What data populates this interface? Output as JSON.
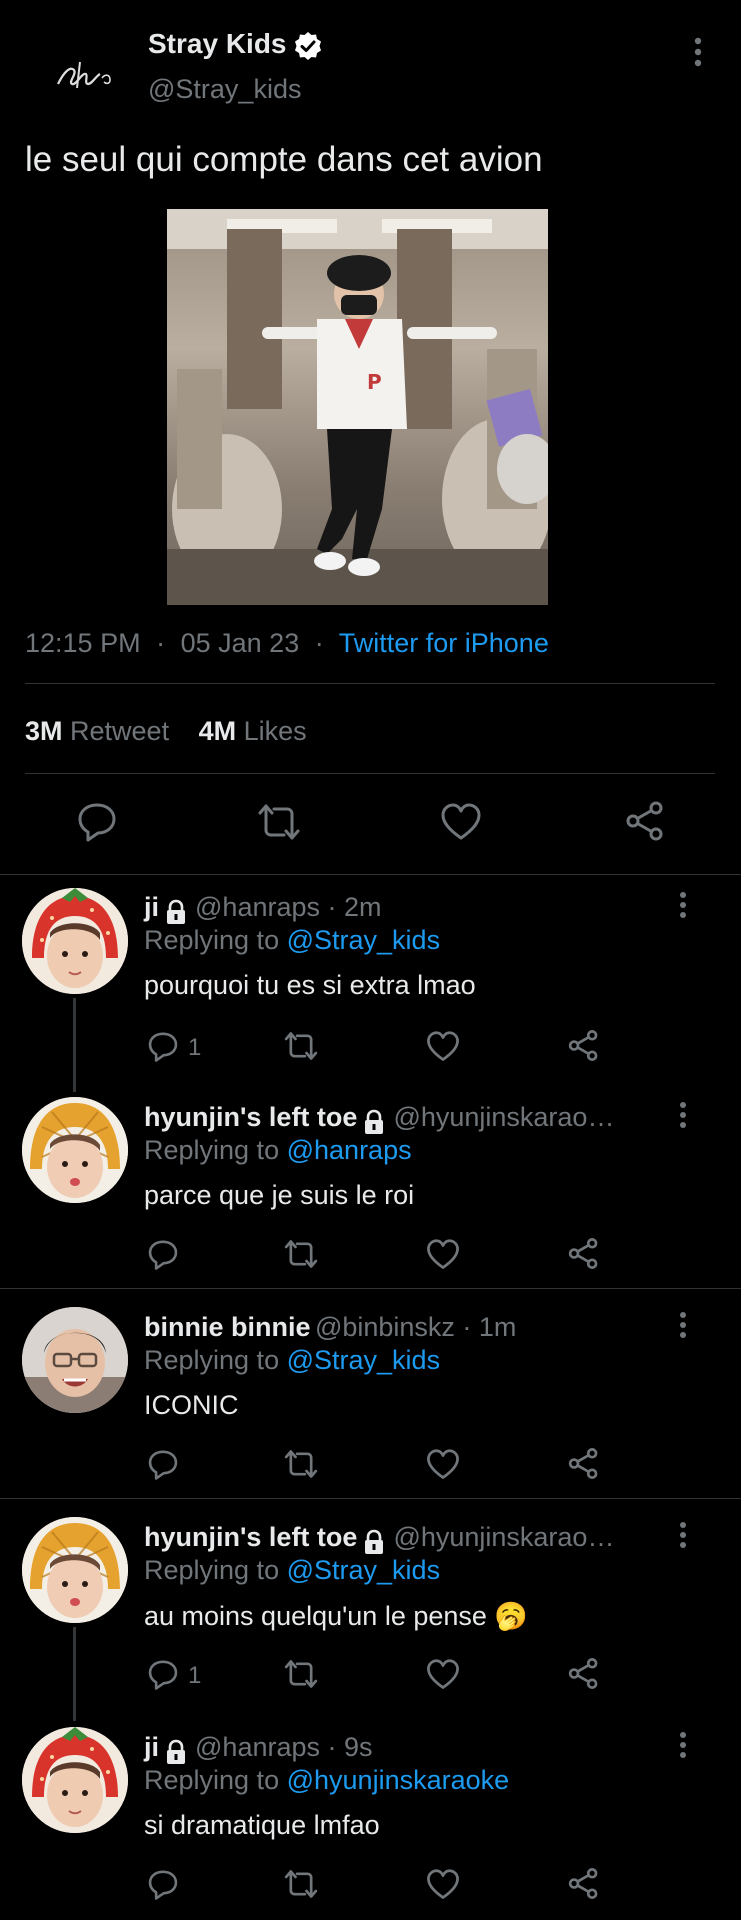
{
  "tweet": {
    "author_name": "Stray Kids",
    "author_handle": "@Stray_kids",
    "text": "le seul qui compte dans cet avion",
    "time": "12:15 PM",
    "date": "05 Jan 23",
    "source": "Twitter for iPhone",
    "retweets_count": "3M",
    "retweets_label": "Retweet",
    "likes_count": "4M",
    "likes_label": "Likes",
    "dot": "·"
  },
  "replies": [
    {
      "name": "ji",
      "handle": "@hanraps · 2m",
      "replying_label": "Replying to",
      "replying_to": "@Stray_kids",
      "text": "pourquoi tu es si extra lmao",
      "reply_count": "1"
    },
    {
      "name": "hyunjin's left toe",
      "handle": "@hyunjinskarao…",
      "replying_label": "Replying to",
      "replying_to": "@hanraps",
      "text": "parce que je suis le roi",
      "reply_count": ""
    },
    {
      "name": "binnie binnie",
      "handle": "@binbinskz · 1m",
      "replying_label": "Replying to",
      "replying_to": "@Stray_kids",
      "text": "ICONIC",
      "reply_count": ""
    },
    {
      "name": "hyunjin's left toe",
      "handle": "@hyunjinskarao…",
      "replying_label": "Replying to",
      "replying_to": "@Stray_kids",
      "text": "au moins quelqu'un le pense 🥱",
      "reply_count": "1"
    },
    {
      "name": "ji",
      "handle": "@hanraps · 9s",
      "replying_label": "Replying to",
      "replying_to": "@hyunjinskaraoke",
      "text": "si dramatique lmfao",
      "reply_count": ""
    }
  ],
  "colors": {
    "background": "#000000",
    "link": "#1d9bf0",
    "muted": "#71767b",
    "divider": "#2f3336",
    "verified": "#ffffff"
  },
  "icons": [
    "more-vertical-icon",
    "verified-badge-icon",
    "reply-icon",
    "retweet-icon",
    "like-icon",
    "share-icon",
    "lock-icon"
  ]
}
